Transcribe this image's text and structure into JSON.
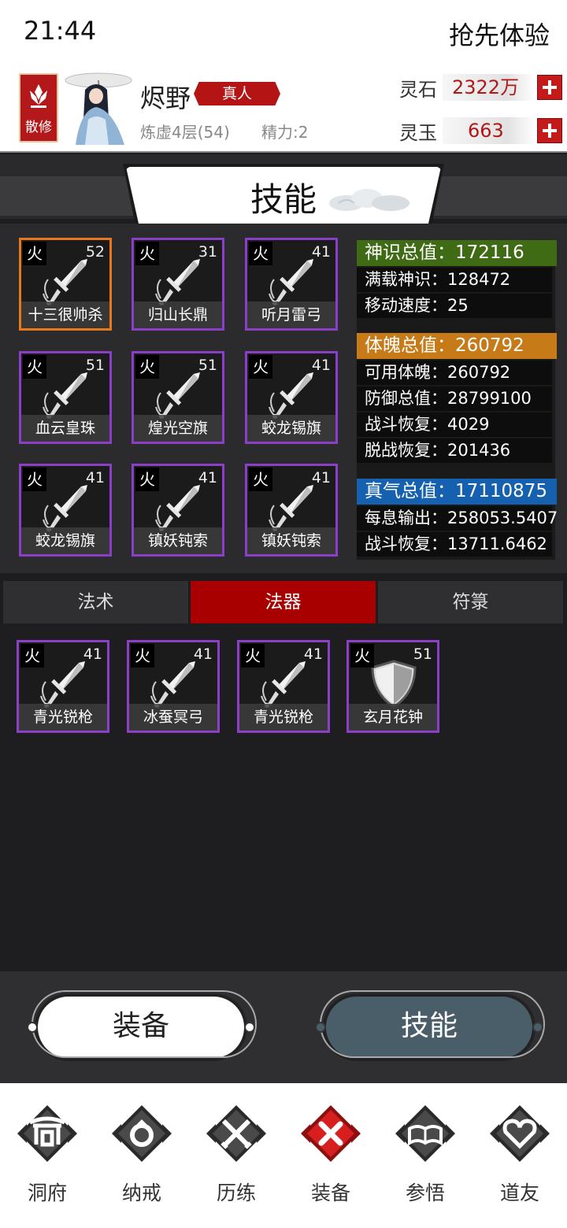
{
  "status_bar": {
    "time": "21:44",
    "early_access": "抢先体验"
  },
  "player": {
    "sect": "散修",
    "name": "烬野",
    "title": "真人",
    "realm": "炼虚4层(54)",
    "energy": "精力:2"
  },
  "currency": {
    "spirit_stone_label": "灵石",
    "spirit_stone_value": "2322万",
    "spirit_jade_label": "灵玉",
    "spirit_jade_value": "663"
  },
  "panel_title": "技能",
  "equipped": [
    {
      "element": "火",
      "level": "52",
      "name": "十三很帅杀",
      "rarity": "orange",
      "icon": "sword-icon"
    },
    {
      "element": "火",
      "level": "31",
      "name": "归山长鼎",
      "rarity": "purple",
      "icon": "sword-icon"
    },
    {
      "element": "火",
      "level": "41",
      "name": "听月雷弓",
      "rarity": "purple",
      "icon": "sword-icon"
    },
    {
      "element": "火",
      "level": "51",
      "name": "血云皇珠",
      "rarity": "purple",
      "icon": "sword-icon"
    },
    {
      "element": "火",
      "level": "51",
      "name": "煌光空旗",
      "rarity": "purple",
      "icon": "sword-icon"
    },
    {
      "element": "火",
      "level": "41",
      "name": "蛟龙锡旗",
      "rarity": "purple",
      "icon": "sword-icon"
    },
    {
      "element": "火",
      "level": "41",
      "name": "蛟龙锡旗",
      "rarity": "purple",
      "icon": "sword-icon"
    },
    {
      "element": "火",
      "level": "41",
      "name": "镇妖钝索",
      "rarity": "purple",
      "icon": "sword-icon"
    },
    {
      "element": "火",
      "level": "41",
      "name": "镇妖钝索",
      "rarity": "purple",
      "icon": "sword-icon"
    }
  ],
  "stats": {
    "shenshi_head": "神识总值：172116",
    "shenshi_color": "#3f6b15",
    "shenshi_rows": [
      "满载神识：128472",
      "移动速度：25"
    ],
    "tipo_head": "体魄总值：260792",
    "tipo_color": "#c77a18",
    "tipo_rows": [
      "可用体魄：260792",
      "防御总值：28799100",
      "战斗恢复：4029",
      "脱战恢复：201436"
    ],
    "zhenqi_head": "真气总值：17110875",
    "zhenqi_color": "#1660b0",
    "zhenqi_rows": [
      "每息输出：258053.5407",
      "战斗恢复：13711.6462"
    ]
  },
  "tabs": [
    {
      "label": "法术",
      "active": false
    },
    {
      "label": "法器",
      "active": true
    },
    {
      "label": "符箓",
      "active": false
    }
  ],
  "inventory": [
    {
      "element": "火",
      "level": "41",
      "name": "青光锐枪",
      "icon": "sword-icon"
    },
    {
      "element": "火",
      "level": "41",
      "name": "冰蚕冥弓",
      "icon": "sword-icon"
    },
    {
      "element": "火",
      "level": "41",
      "name": "青光锐枪",
      "icon": "sword-icon"
    },
    {
      "element": "火",
      "level": "51",
      "name": "玄月花钟",
      "icon": "shield-icon"
    }
  ],
  "buttons": {
    "equip": "装备",
    "skill": "技能"
  },
  "nav": [
    {
      "label": "洞府",
      "icon": "gate-icon",
      "active": false
    },
    {
      "label": "纳戒",
      "icon": "ring-icon",
      "active": false
    },
    {
      "label": "历练",
      "icon": "crossed-swords-icon",
      "active": false
    },
    {
      "label": "装备",
      "icon": "close-icon",
      "active": true
    },
    {
      "label": "参悟",
      "icon": "book-icon",
      "active": false
    },
    {
      "label": "道友",
      "icon": "heart-icon",
      "active": false
    }
  ]
}
